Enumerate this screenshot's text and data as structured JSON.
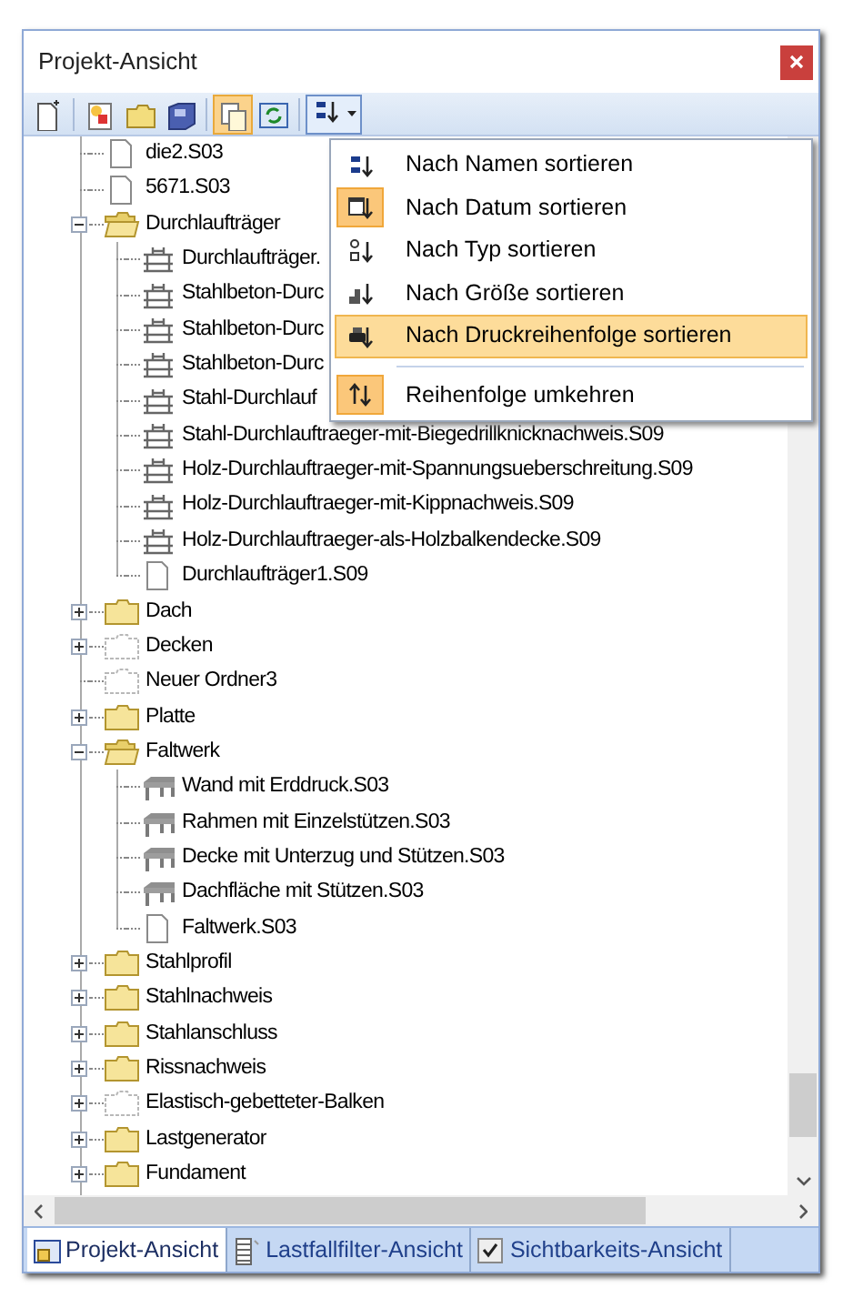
{
  "window": {
    "title": "Projekt-Ansicht"
  },
  "toolbar": [
    {
      "kind": "new-file",
      "pressed": false
    },
    {
      "kind": "separator"
    },
    {
      "kind": "new-item",
      "pressed": false
    },
    {
      "kind": "folder",
      "pressed": false
    },
    {
      "kind": "disk",
      "pressed": false
    },
    {
      "kind": "separator"
    },
    {
      "kind": "copy",
      "pressed": true
    },
    {
      "kind": "refresh",
      "pressed": false
    },
    {
      "kind": "separator"
    },
    {
      "kind": "sort",
      "pressed": true
    }
  ],
  "tree": [
    {
      "label": "die2.S03",
      "kind": "file"
    },
    {
      "label": "5671.S03",
      "kind": "file"
    },
    {
      "label": "Durchlaufträger",
      "kind": "folder",
      "expanded": true,
      "children": [
        {
          "label": "Durchlaufträger.",
          "kind": "beam"
        },
        {
          "label": "Stahlbeton-Durc",
          "kind": "beam"
        },
        {
          "label": "Stahlbeton-Durc",
          "kind": "beam"
        },
        {
          "label": "Stahlbeton-Durc",
          "kind": "beam"
        },
        {
          "label": "Stahl-Durchlauf",
          "kind": "beam"
        },
        {
          "label": "Stahl-Durchlauftraeger-mit-Biegedrillknicknachweis.S09",
          "kind": "beam"
        },
        {
          "label": "Holz-Durchlauftraeger-mit-Spannungsueberschreitung.S09",
          "kind": "beam"
        },
        {
          "label": "Holz-Durchlauftraeger-mit-Kippnachweis.S09",
          "kind": "beam"
        },
        {
          "label": "Holz-Durchlauftraeger-als-Holzbalkendecke.S09",
          "kind": "beam"
        },
        {
          "label": "Durchlaufträger1.S09",
          "kind": "file"
        }
      ]
    },
    {
      "label": "Dach",
      "kind": "folder",
      "expanded": false
    },
    {
      "label": "Decken",
      "kind": "empty-folder",
      "expanded": false
    },
    {
      "label": "Neuer Ordner3",
      "kind": "empty-folder"
    },
    {
      "label": "Platte",
      "kind": "folder",
      "expanded": false
    },
    {
      "label": "Faltwerk",
      "kind": "folder",
      "expanded": true,
      "children": [
        {
          "label": "Wand mit Erddruck.S03",
          "kind": "slab"
        },
        {
          "label": "Rahmen mit Einzelstützen.S03",
          "kind": "slab"
        },
        {
          "label": "Decke mit Unterzug und Stützen.S03",
          "kind": "slab"
        },
        {
          "label": "Dachfläche mit Stützen.S03",
          "kind": "slab"
        },
        {
          "label": "Faltwerk.S03",
          "kind": "file"
        }
      ]
    },
    {
      "label": "Stahlprofil",
      "kind": "folder",
      "expanded": false
    },
    {
      "label": "Stahlnachweis",
      "kind": "folder",
      "expanded": false
    },
    {
      "label": "Stahlanschluss",
      "kind": "folder",
      "expanded": false
    },
    {
      "label": "Rissnachweis",
      "kind": "folder",
      "expanded": false
    },
    {
      "label": "Elastisch-gebetteter-Balken",
      "kind": "empty-folder",
      "expanded": false
    },
    {
      "label": "Lastgenerator",
      "kind": "folder",
      "expanded": false
    },
    {
      "label": "Fundament",
      "kind": "folder",
      "expanded": false
    }
  ],
  "sort_menu": [
    {
      "kind": "name",
      "label": "Nach Namen sortieren",
      "checked": false,
      "selected": false
    },
    {
      "kind": "date",
      "label": "Nach Datum sortieren",
      "checked": true,
      "selected": false
    },
    {
      "kind": "type",
      "label": "Nach Typ sortieren",
      "checked": false,
      "selected": false
    },
    {
      "kind": "size",
      "label": "Nach Größe sortieren",
      "checked": false,
      "selected": false
    },
    {
      "kind": "print",
      "label": "Nach Druckreihenfolge sortieren",
      "checked": false,
      "selected": true
    },
    {
      "kind": "separator"
    },
    {
      "kind": "reverse",
      "label": "Reihenfolge umkehren",
      "checked": true,
      "selected": false
    }
  ],
  "tabs": [
    {
      "kind": "project",
      "label": "Projekt-Ansicht",
      "selected": true
    },
    {
      "kind": "filter",
      "label": "Lastfallfilter-Ansicht",
      "selected": false
    },
    {
      "kind": "visibility",
      "label": "Sichtbarkeits-Ansicht",
      "selected": false
    }
  ]
}
